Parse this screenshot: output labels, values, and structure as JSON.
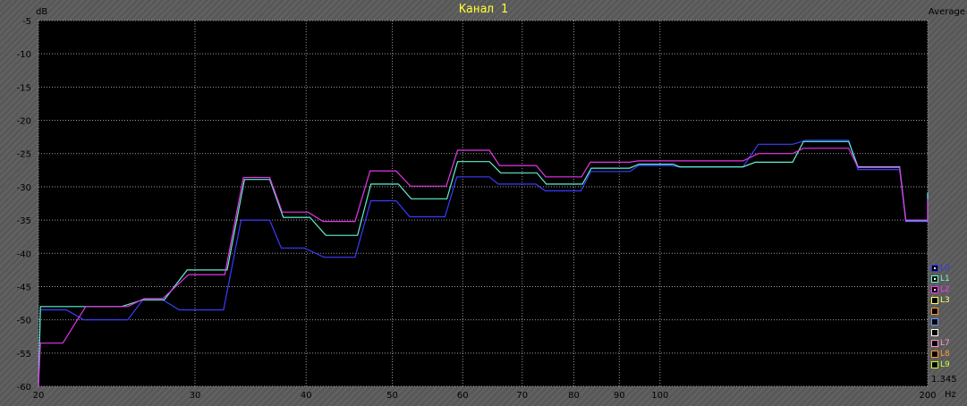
{
  "header": {
    "title": "Канал 1",
    "y_unit": "dB",
    "x_unit": "Hz",
    "mode": "Average"
  },
  "legend": [
    {
      "label": "L0",
      "color": "#3333ff",
      "checked": true
    },
    {
      "label": "L1",
      "color": "#66ffcc",
      "checked": true
    },
    {
      "label": "L2",
      "color": "#ff33ff",
      "checked": true
    },
    {
      "label": "L3",
      "color": "#ffff66",
      "checked": false
    },
    {
      "label": "",
      "color": "#ff9933",
      "checked": false
    },
    {
      "label": "",
      "color": "#6699ff",
      "checked": false
    },
    {
      "label": "",
      "color": "#ffffff",
      "checked": false
    },
    {
      "label": "L7",
      "color": "#ff99cc",
      "checked": false
    },
    {
      "label": "L8",
      "color": "#ff9933",
      "checked": false
    },
    {
      "label": "L9",
      "color": "#ccff33",
      "checked": false
    }
  ],
  "level_value": "1.345",
  "chart_data": {
    "type": "line",
    "title": "Канал 1",
    "xlabel": "Hz",
    "ylabel": "dB",
    "x_scale": "log",
    "xlim": [
      20,
      200
    ],
    "ylim": [
      -60,
      -5
    ],
    "x_ticks": [
      20,
      30,
      40,
      50,
      60,
      70,
      80,
      90,
      100,
      200
    ],
    "y_ticks": [
      -5,
      -10,
      -15,
      -20,
      -25,
      -30,
      -35,
      -40,
      -45,
      -50,
      -55,
      -60
    ],
    "grid": true,
    "series": [
      {
        "name": "L0",
        "color": "#3b3bff",
        "points": [
          [
            20,
            -60
          ],
          [
            20.1,
            -48.5
          ],
          [
            21.5,
            -48.5
          ],
          [
            22.5,
            -50
          ],
          [
            25.2,
            -50
          ],
          [
            26.2,
            -47
          ],
          [
            27.6,
            -47
          ],
          [
            28.8,
            -48.5
          ],
          [
            32.3,
            -48.5
          ],
          [
            33.8,
            -35
          ],
          [
            36.4,
            -35
          ],
          [
            37.5,
            -39.2
          ],
          [
            39.8,
            -39.2
          ],
          [
            41.9,
            -40.6
          ],
          [
            45.4,
            -40.6
          ],
          [
            47.3,
            -32.1
          ],
          [
            50.5,
            -32.1
          ],
          [
            52.3,
            -34.5
          ],
          [
            57.3,
            -34.5
          ],
          [
            59.1,
            -28.5
          ],
          [
            64.3,
            -28.5
          ],
          [
            65.8,
            -29.6
          ],
          [
            72.5,
            -29.6
          ],
          [
            74.3,
            -30.6
          ],
          [
            81.5,
            -30.6
          ],
          [
            83.6,
            -27.7
          ],
          [
            92.5,
            -27.7
          ],
          [
            94.6,
            -26.8
          ],
          [
            103,
            -26.8
          ],
          [
            105,
            -27
          ],
          [
            124,
            -27
          ],
          [
            129,
            -23.6
          ],
          [
            141,
            -23.6
          ],
          [
            146,
            -23
          ],
          [
            163,
            -23
          ],
          [
            167,
            -27.4
          ],
          [
            186,
            -27.4
          ],
          [
            189,
            -35.2
          ],
          [
            203,
            -35.2
          ],
          [
            207,
            -31
          ]
        ]
      },
      {
        "name": "L1",
        "color": "#5ff2cf",
        "points": [
          [
            20,
            -60
          ],
          [
            20.1,
            -48
          ],
          [
            24.8,
            -48
          ],
          [
            26.2,
            -47
          ],
          [
            27.7,
            -47
          ],
          [
            29.4,
            -42.5
          ],
          [
            32.6,
            -42.5
          ],
          [
            34.1,
            -28.9
          ],
          [
            36.4,
            -28.9
          ],
          [
            37.7,
            -34.6
          ],
          [
            40.4,
            -34.6
          ],
          [
            42.1,
            -37.3
          ],
          [
            45.7,
            -37.3
          ],
          [
            47.3,
            -29.6
          ],
          [
            50.8,
            -29.6
          ],
          [
            52.5,
            -31.8
          ],
          [
            57.6,
            -31.8
          ],
          [
            59.2,
            -26.2
          ],
          [
            64.3,
            -26.2
          ],
          [
            66.2,
            -27.9
          ],
          [
            72.7,
            -27.9
          ],
          [
            74.5,
            -29.6
          ],
          [
            81.8,
            -29.6
          ],
          [
            83.7,
            -27.2
          ],
          [
            92.4,
            -27.2
          ],
          [
            94.7,
            -26.6
          ],
          [
            103.5,
            -26.6
          ],
          [
            105.2,
            -27
          ],
          [
            124,
            -27
          ],
          [
            128,
            -26.3
          ],
          [
            141,
            -26.3
          ],
          [
            145,
            -23.2
          ],
          [
            163,
            -23.2
          ],
          [
            167,
            -27
          ],
          [
            186,
            -27
          ],
          [
            189,
            -35.1
          ],
          [
            203,
            -35.1
          ],
          [
            207,
            -30.9
          ]
        ]
      },
      {
        "name": "L2",
        "color": "#e535e5",
        "points": [
          [
            20,
            -60
          ],
          [
            20.1,
            -53.5
          ],
          [
            21.3,
            -53.5
          ],
          [
            22.6,
            -48
          ],
          [
            25.2,
            -48
          ],
          [
            26.3,
            -46.8
          ],
          [
            27.6,
            -46.8
          ],
          [
            29.5,
            -43.2
          ],
          [
            32.4,
            -43.2
          ],
          [
            34,
            -28.6
          ],
          [
            36.4,
            -28.6
          ],
          [
            37.6,
            -33.8
          ],
          [
            40.2,
            -33.8
          ],
          [
            41.8,
            -35.2
          ],
          [
            45.4,
            -35.2
          ],
          [
            47.2,
            -27.6
          ],
          [
            50.5,
            -27.6
          ],
          [
            52.4,
            -29.9
          ],
          [
            57.5,
            -29.9
          ],
          [
            59.2,
            -24.5
          ],
          [
            64.3,
            -24.5
          ],
          [
            66,
            -26.8
          ],
          [
            72.6,
            -26.8
          ],
          [
            74.4,
            -28.5
          ],
          [
            81.6,
            -28.5
          ],
          [
            83.5,
            -26.3
          ],
          [
            92.5,
            -26.3
          ],
          [
            94.5,
            -26.1
          ],
          [
            124,
            -26.1
          ],
          [
            129,
            -25
          ],
          [
            141,
            -25
          ],
          [
            145,
            -24.2
          ],
          [
            163,
            -24.2
          ],
          [
            167,
            -27.1
          ],
          [
            186,
            -27.1
          ],
          [
            189,
            -35
          ],
          [
            203,
            -35
          ],
          [
            207,
            -31.8
          ]
        ]
      }
    ]
  }
}
